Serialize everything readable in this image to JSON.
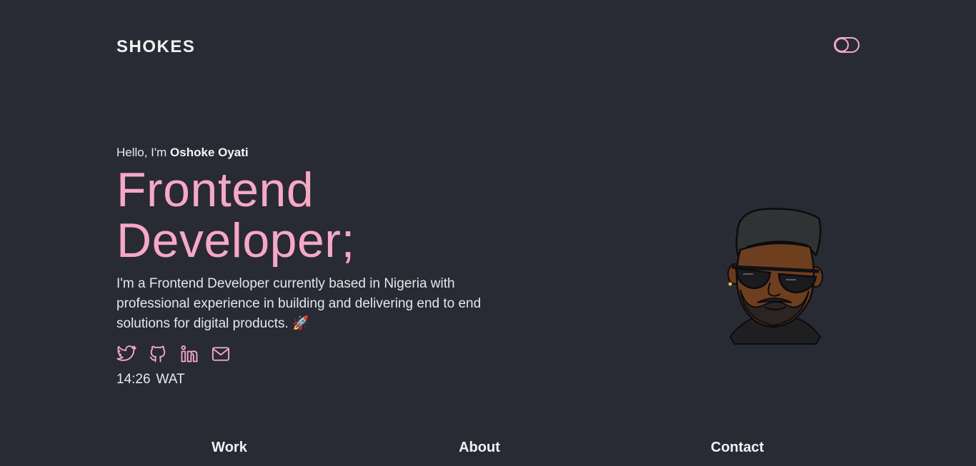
{
  "header": {
    "logo": "SHOKES",
    "theme_toggle_icon": "toggle-icon"
  },
  "hero": {
    "greeting_prefix": "Hello, I'm ",
    "name": "Oshoke Oyati",
    "title_line1": "Frontend",
    "title_line2": "Developer;",
    "bio": "I'm a Frontend Developer currently based in Nigeria with professional experience in building and delivering end to end solutions for digital products.",
    "bio_emoji": "🚀",
    "socials": [
      {
        "icon": "twitter-icon"
      },
      {
        "icon": "github-icon"
      },
      {
        "icon": "linkedin-icon"
      },
      {
        "icon": "mail-icon"
      }
    ],
    "time": "14:26",
    "timezone": "WAT"
  },
  "nav": {
    "items": [
      "Work",
      "About",
      "Contact"
    ]
  },
  "colors": {
    "background": "#292b34",
    "accent": "#f6a8c6",
    "text": "#e9e9ee"
  }
}
